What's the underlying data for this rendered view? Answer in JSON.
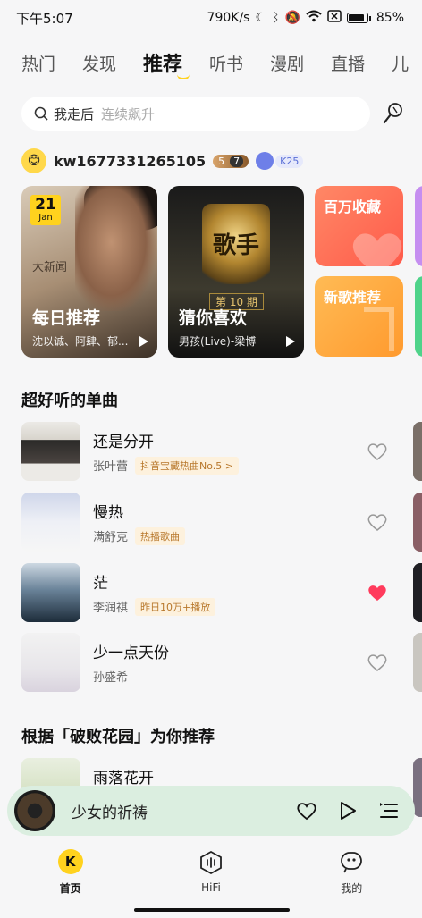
{
  "status_bar": {
    "time": "下午5:07",
    "network_speed": "790K/s",
    "battery": "85%"
  },
  "top_tabs": [
    {
      "label": "热门"
    },
    {
      "label": "发现"
    },
    {
      "label": "推荐"
    },
    {
      "label": "听书"
    },
    {
      "label": "漫剧"
    },
    {
      "label": "直播"
    },
    {
      "label": "儿"
    }
  ],
  "active_tab": "推荐",
  "search": {
    "term": "我走后",
    "hint": "连续飙升"
  },
  "user": {
    "name": "kw1677331265105",
    "level_a": "5",
    "level_b": "7",
    "k_badge": "K25"
  },
  "cards": {
    "daily": {
      "day": "21",
      "month": "Jan",
      "title": "每日推荐",
      "subtitle": "沈以诚、阿肆、郁...",
      "art_text": "大新闻"
    },
    "guess": {
      "title": "猜你喜欢",
      "subtitle": "男孩(Live)-梁博",
      "art_text": "歌手",
      "issue_text": "第 10 期"
    },
    "favorites": {
      "title": "百万收藏"
    },
    "new_songs": {
      "title": "新歌推荐"
    }
  },
  "section_singles": "超好听的单曲",
  "songs": [
    {
      "title": "还是分开",
      "artist": "张叶蕾",
      "tag": "抖音宝藏热曲No.5 >",
      "liked": false
    },
    {
      "title": "慢热",
      "artist": "满舒克",
      "tag": "热播歌曲",
      "liked": false
    },
    {
      "title": "茫",
      "artist": "李润祺",
      "tag": "昨日10万+播放",
      "liked": true
    },
    {
      "title": "少一点天份",
      "artist": "孙盛希",
      "tag": "",
      "liked": false
    }
  ],
  "section_recommend": "根据「破败花园」为你推荐",
  "recommend_song": {
    "title": "雨落花开"
  },
  "player": {
    "title": "少女的祈祷"
  },
  "bottom_nav": {
    "home": "首页",
    "hifi": "HiFi",
    "mine": "我的"
  },
  "colors": {
    "accent": "#ffd21e",
    "like": "#ff3b5c",
    "player_bg": "#dbeee0",
    "tag_text": "#b8782c",
    "tag_bg": "#fdf1dd"
  }
}
